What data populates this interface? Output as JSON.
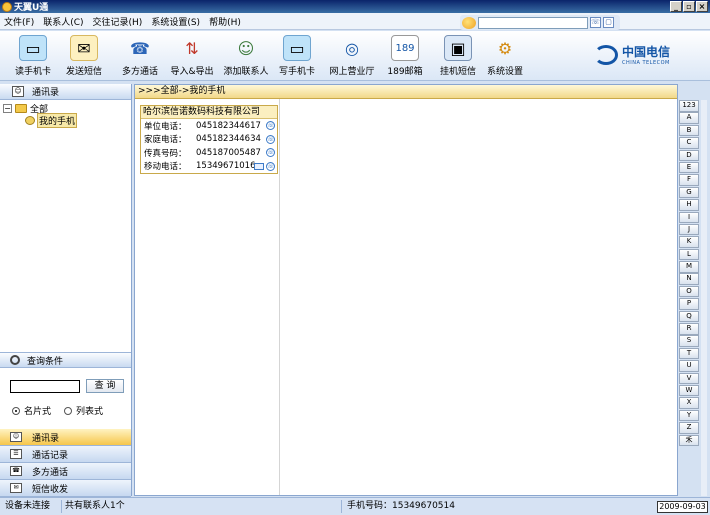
{
  "window": {
    "title": "天翼U通"
  },
  "menu": [
    "文件(F)",
    "联系人(C)",
    "交往记录(H)",
    "系统设置(S)",
    "帮助(H)"
  ],
  "toolbar": {
    "items": [
      {
        "label": "读手机卡",
        "icon": "sim-card-read-icon"
      },
      {
        "label": "发送短信",
        "icon": "envelope-icon"
      },
      {
        "label": "多方通话",
        "icon": "multi-call-icon"
      },
      {
        "label": "导入&导出",
        "icon": "import-export-icon"
      },
      {
        "label": "添加联系人",
        "icon": "add-contact-icon"
      },
      {
        "label": "写手机卡",
        "icon": "sim-card-write-icon"
      },
      {
        "label": "网上营业厅",
        "icon": "online-hall-icon"
      },
      {
        "label": "189邮箱",
        "icon": "mail189-icon"
      },
      {
        "label": "挂机短信",
        "icon": "hangup-sms-icon"
      },
      {
        "label": "系统设置",
        "icon": "settings-gear-icon"
      }
    ],
    "brand_cn": "中国电信",
    "brand_en": "CHINA TELECOM"
  },
  "left": {
    "header": "通讯录",
    "tree": [
      {
        "label": "全部",
        "expander": "□"
      },
      {
        "label": "我的手机"
      }
    ],
    "query_header": "查询条件",
    "query_button": "查 询",
    "radio_card": "名片式",
    "radio_list": "列表式",
    "nav": [
      "通讯录",
      "通话记录",
      "多方通话",
      "短信收发"
    ]
  },
  "main": {
    "breadcrumb": ">>>全部->我的手机",
    "card": {
      "company": "哈尔滨信诺数码科技有限公司",
      "rows": [
        {
          "label": "单位电话：",
          "value": "045182344617"
        },
        {
          "label": "家庭电话：",
          "value": "045182344634"
        },
        {
          "label": "传真号码：",
          "value": "045187005487"
        },
        {
          "label": "移动电话：",
          "value": "15349671016"
        }
      ]
    }
  },
  "alphabet": [
    "123",
    "A",
    "B",
    "C",
    "D",
    "E",
    "F",
    "G",
    "H",
    "I",
    "J",
    "K",
    "L",
    "M",
    "N",
    "O",
    "P",
    "Q",
    "R",
    "S",
    "T",
    "U",
    "V",
    "W",
    "X",
    "Y",
    "Z",
    "禾"
  ],
  "status": {
    "device": "设备未连接",
    "count": "共有联系人1个",
    "phone": "手机号码：15349670514",
    "date": "2009-09-03"
  }
}
